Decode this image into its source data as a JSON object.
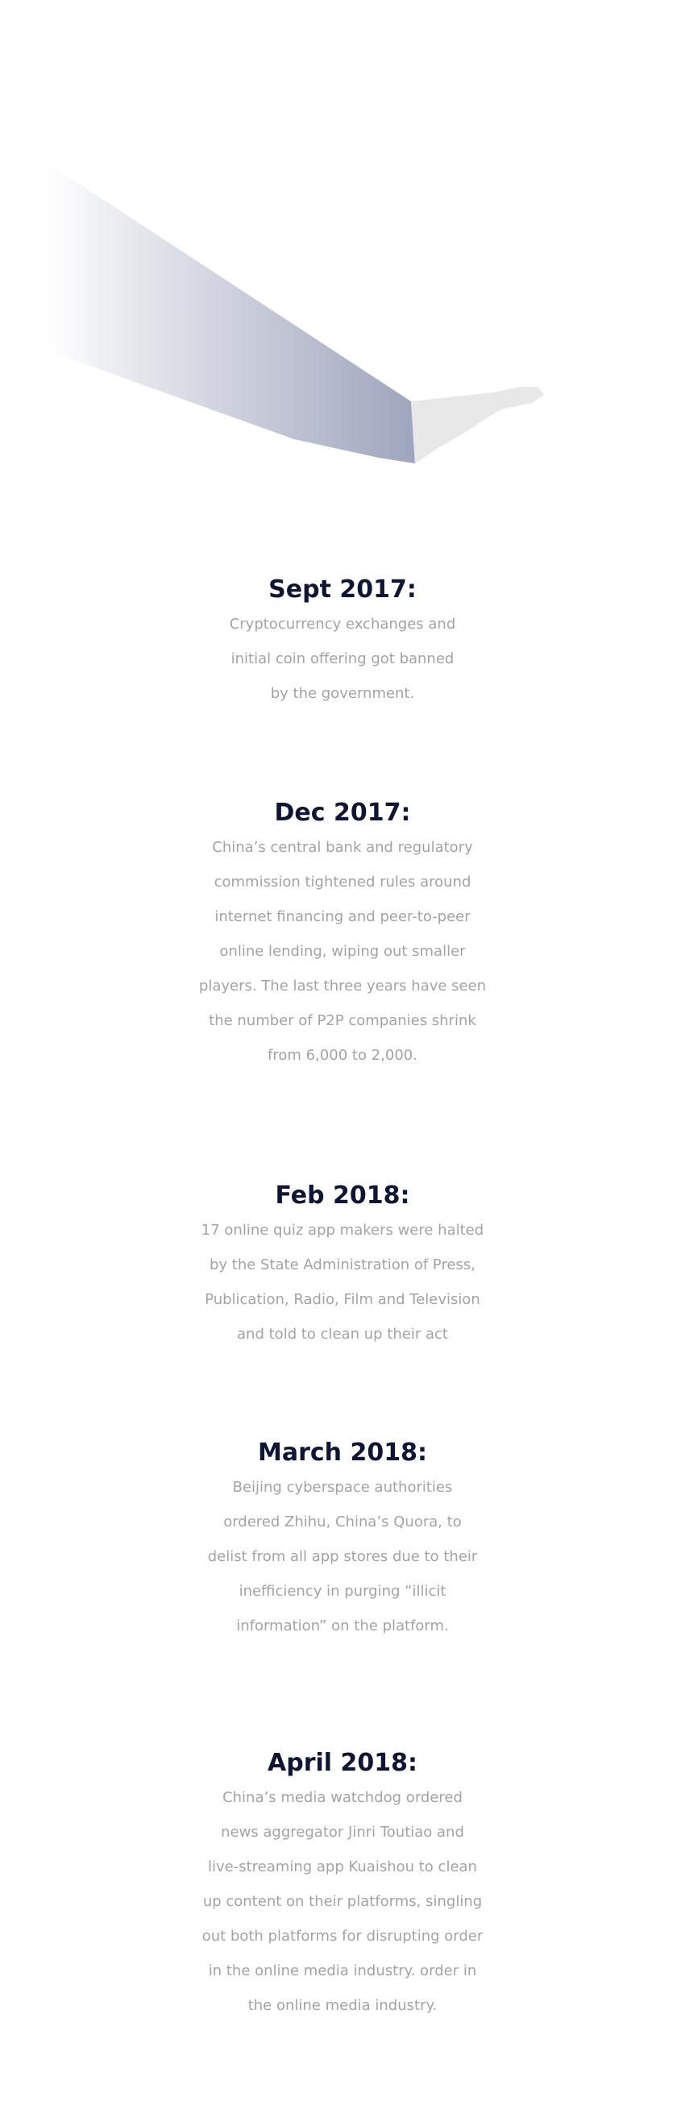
{
  "timeline": [
    {
      "date": "Sept 2017:",
      "lines": [
        "Cryptocurrency exchanges and",
        "initial coin offering got banned",
        "by the government."
      ]
    },
    {
      "date": "Dec 2017:",
      "lines": [
        "China’s central bank and regulatory",
        "commission tightened rules around",
        "internet financing and peer-to-peer",
        "online lending, wiping out smaller",
        "players. The last three years have seen",
        "the number of P2P companies shrink",
        "from 6,000 to 2,000."
      ]
    },
    {
      "date": "Feb 2018:",
      "lines": [
        "17 online quiz app makers were halted",
        "by the State Administration of Press,",
        "Publication, Radio, Film and Television",
        "and told to clean up their act"
      ]
    },
    {
      "date": "March 2018:",
      "lines": [
        "Beijing cyberspace authorities",
        "ordered Zhihu, China’s Quora, to",
        "delist from all app stores due to their",
        "inefficiency in purging “illicit",
        "information” on the platform."
      ]
    },
    {
      "date": "April 2018:",
      "lines": [
        "China’s media watchdog ordered",
        "news aggregator Jinri Toutiao and",
        "live-streaming app Kuaishou to clean",
        "up content on their platforms, singling",
        "out both platforms for disrupting order",
        "in the online media industry. order in",
        "the online media industry."
      ]
    }
  ],
  "colors": {
    "date": "#0f1535",
    "body_text": "#a3a3a3",
    "beam_start": "#ffffff",
    "beam_end": "#9ea5bd",
    "hand": "#e8e8e8"
  }
}
